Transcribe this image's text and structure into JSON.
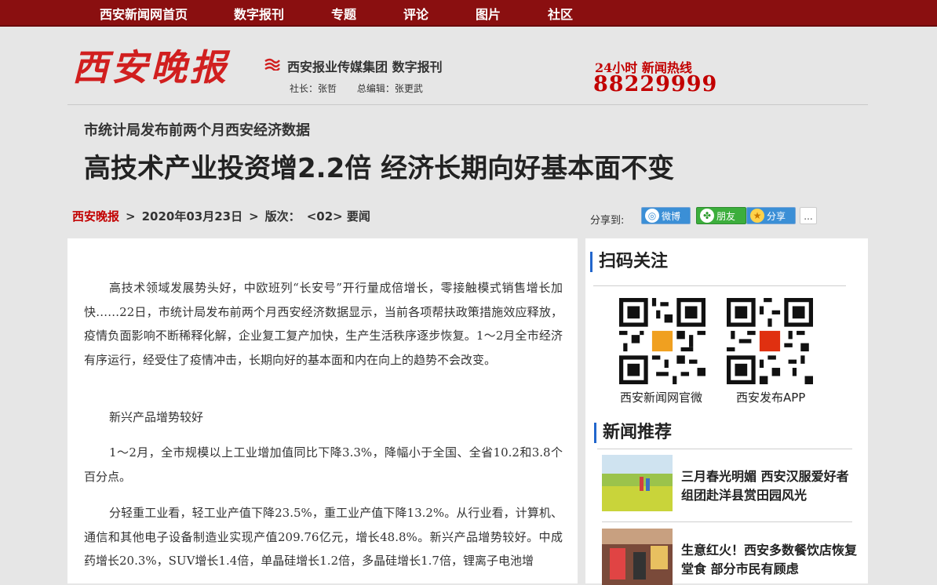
{
  "nav": {
    "items": [
      "西安新闻网首页",
      "数字报刊",
      "专题",
      "评论",
      "图片",
      "社区"
    ]
  },
  "header": {
    "logo_text": "西安晚报",
    "group_name": "西安报业传媒集团 数字报刊",
    "president": "社长：张哲",
    "chief_editor": "总编辑：张更武",
    "hotline_label": "24小时 新闻热线",
    "hotline_number": "88229999"
  },
  "article": {
    "subtitle": "市统计局发布前两个月西安经济数据",
    "title": "高技术产业投资增2.2倍 经济长期向好基本面不变",
    "breadcrumb": {
      "paper": "西安晚报",
      "date": "2020年03月23日",
      "edition_label": "版次：",
      "edition": "<02> 要闻",
      "separator": ">"
    },
    "paragraphs": [
      "高技术领域发展势头好，中欧班列“长安号”开行量成倍增长，零接触模式销售增长加快……22日，市统计局发布前两个月西安经济数据显示，当前各项帮扶政策措施效应释放，疫情负面影响不断稀释化解，企业复工复产加快，生产生活秩序逐步恢复。1～2月全市经济有序运行，经受住了疫情冲击，长期向好的基本面和内在向上的趋势不会改变。",
      "新兴产品增势较好",
      "1～2月，全市规模以上工业增加值同比下降3.3%，降幅小于全国、全省10.2和3.8个百分点。",
      "分轻重工业看，轻工业产值下降23.5%，重工业产值下降13.2%。从行业看，计算机、通信和其他电子设备制造业实现产值209.76亿元，增长48.8%。新兴产品增势较好。中成药增长20.3%，SUV增长1.4倍，单晶硅增长1.2倍，多晶硅增长1.7倍，锂离子电池增"
    ]
  },
  "share": {
    "label": "分享到:",
    "weibo": "微博",
    "friends": "朋友",
    "share": "分享",
    "more": "..."
  },
  "sidebar": {
    "qr_title": "扫码关注",
    "qr_items": [
      {
        "caption": "西安新闻网官微"
      },
      {
        "caption": "西安发布APP"
      }
    ],
    "news_title": "新闻推荐",
    "news": [
      {
        "title": "三月春光明媚 西安汉服爱好者组团赴洋县赏田园风光"
      },
      {
        "title": "生意红火！西安多数餐饮店恢复堂食 部分市民有顾虑"
      }
    ]
  },
  "colors": {
    "nav_bg": "#8a0f10",
    "brand_red": "#d11f1f",
    "accent_blue": "#2266cc"
  }
}
